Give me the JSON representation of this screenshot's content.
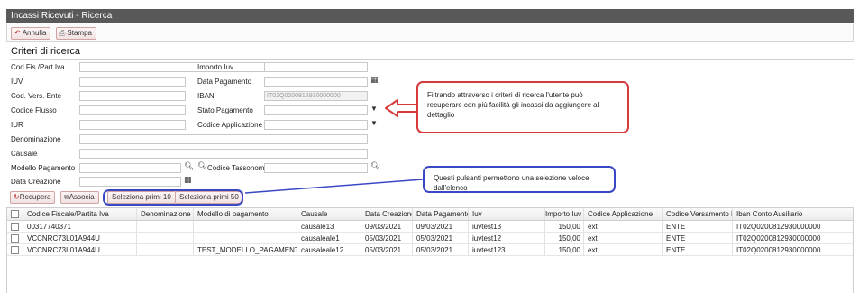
{
  "window": {
    "title": "Incassi Ricevuti - Ricerca"
  },
  "toolbar": {
    "annulla_label": "Annulla",
    "stampa_label": "Stampa"
  },
  "criteria": {
    "title": "Criteri di ricerca",
    "fields": {
      "cod_fis": {
        "label": "Cod.Fis./Part.Iva",
        "value": ""
      },
      "iuv": {
        "label": "IUV",
        "value": ""
      },
      "cod_vers_ente": {
        "label": "Cod. Vers. Ente",
        "value": ""
      },
      "codice_flusso": {
        "label": "Codice Flusso",
        "value": ""
      },
      "iur": {
        "label": "IUR",
        "value": ""
      },
      "denominazione": {
        "label": "Denominazione",
        "value": ""
      },
      "causale": {
        "label": "Causale",
        "value": ""
      },
      "modello_pagamento": {
        "label": "Modello Pagamento",
        "value": ""
      },
      "data_creazione": {
        "label": "Data Creazione",
        "value": ""
      },
      "importo_iuv": {
        "label": "Importo Iuv",
        "value": ""
      },
      "data_pagamento": {
        "label": "Data Pagamento",
        "value": ""
      },
      "iban": {
        "label": "IBAN",
        "value": "IT02Q0200812930000000"
      },
      "stato_pagamento": {
        "label": "Stato Pagamento",
        "value": ""
      },
      "codice_applicazione": {
        "label": "Codice Applicazione",
        "value": ""
      },
      "codice_tassonomia": {
        "label": "Codice Tassonomia",
        "value": ""
      }
    }
  },
  "callouts": {
    "filters": "Filtrando attraverso i criteri di ricerca l'utente può recuperare con più facilità gli incassi da aggiungere al dettaglio",
    "buttons": "Questi pulsanti permettono una selezione veloce dall'elenco"
  },
  "actions": {
    "recupera_label": "Recupera",
    "associa_label": "Associa",
    "primi10_label": "Seleziona primi 10",
    "primi50_label": "Seleziona primi 50"
  },
  "icons": {
    "annulla": "undo-icon",
    "stampa": "print-icon",
    "recupera": "refresh-icon",
    "associa": "link-icon",
    "calendar": "calendar-icon",
    "search": "search-icon",
    "dropdown": "dropdown-arrow-icon"
  },
  "colors": {
    "titlebar": "#595959",
    "callout_red": "#d63a3a",
    "callout_blue": "#3b48c4",
    "button_border": "#d0a3a3"
  },
  "table": {
    "columns": [
      "Codice Fiscale/Partita Iva",
      "Denominazione",
      "Modello di pagamento",
      "Causale",
      "Data Creazione",
      "Data Pagamento",
      "Iuv",
      "Importo Iuv",
      "Codice Applicazione",
      "Codice Versamento E...",
      "Iban Conto Ausiliario"
    ],
    "rows": [
      [
        "00317740371",
        "",
        "",
        "causale13",
        "09/03/2021",
        "09/03/2021",
        "iuvtest13",
        "150,00",
        "ext",
        "ENTE",
        "IT02Q0200812930000000"
      ],
      [
        "VCCNRC73L01A944U",
        "",
        "",
        "causaleale1",
        "05/03/2021",
        "05/03/2021",
        "iuvtest12",
        "150,00",
        "ext",
        "ENTE",
        "IT02Q0200812930000000"
      ],
      [
        "VCCNRC73L01A944U",
        "",
        "TEST_MODELLO_PAGAMENTO",
        "causaleale12",
        "05/03/2021",
        "05/03/2021",
        "iuvtest123",
        "150,00",
        "ext",
        "ENTE",
        "IT02Q0200812930000000"
      ]
    ]
  }
}
